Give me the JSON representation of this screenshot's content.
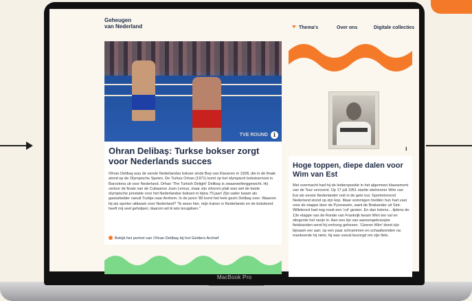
{
  "device": {
    "brand": "MacBook Pro"
  },
  "nav": {
    "logo_line1": "Geheugen",
    "logo_line2": "van Nederland",
    "items": [
      "Thema's",
      "Over ons",
      "Digitale collecties"
    ]
  },
  "article_left": {
    "photo_caption": "TVE ROUND",
    "title": "Ohran Delibaş: Turkse bokser zorgt voor Nederlands succes",
    "body": "Ohran Delibaş was de eerste Nederlandse bokser sinds Bep van Klaveren in 1928, die in de finale stond op de Olympische Spelen. De Turkse Orhan (1971) komt op het olympisch bokstoernooi in Barcelona uit voor Nederland. Orhan 'The Turkish Delight' Delibaş is zwaarwelterggewicht. Hij verloor de finale van de Cubaanse Juan Lemus, maar zijn zilveren plak was wel de beste olympische prestatie voor het Nederlandse boksen in bijna 70 jaar! Zijn vader kwam als gastarbeider vanuit Turkije naar Arnhem. In de jaren '80 komt het hele gezin Delibaş over. Waarom hij als sporter uitkwam voor Nederland? \"Ik woon hier, mijn trainer is Nederlands en de boksbond heeft mij veel geholpen; daarom wil ik iets terugdoen.\"",
    "link": "Bekijk het portret van Ohran Delibaş bij het Gelders Archief"
  },
  "article_right": {
    "title": "Hoge toppen, diepe dalen voor Wim van Est",
    "body": "Met overmacht had hij de leiderspositie in het algemeen klassement van de Tour veroverd. Op 17 juli 1951 startte wielrenner Wim van Est als eerste Nederlander ooit in de gele trui. Sportminnend Nederland stond op zijn kop. Maar sommigen hielden hun hart vast voor de etappe door de Pyreneeën, want de Brabander uit Sint-Willebrord had nog nooit een 'col' gezien. En dan inéens... tijdens de 13e etappe van de Ronde van Frankrijk kwam Wim ten val en slingerde het ravijn in. Aan een lijn van aaneengeknoopte fietsbanden werd hij omhoog gehesen. 'IJzeren Wim' deed zijn bijnaam eer aan; op een paar schrammen en schaafwonden na mankeerde hij niets; hij was vooral bezorgd om zijn fiets."
  },
  "icons": {
    "info": "i"
  },
  "colors": {
    "accent_orange": "#f47a2a",
    "accent_green": "#7dd98a",
    "heading_navy": "#1e2a44",
    "page_bg": "#fbf7ee"
  }
}
